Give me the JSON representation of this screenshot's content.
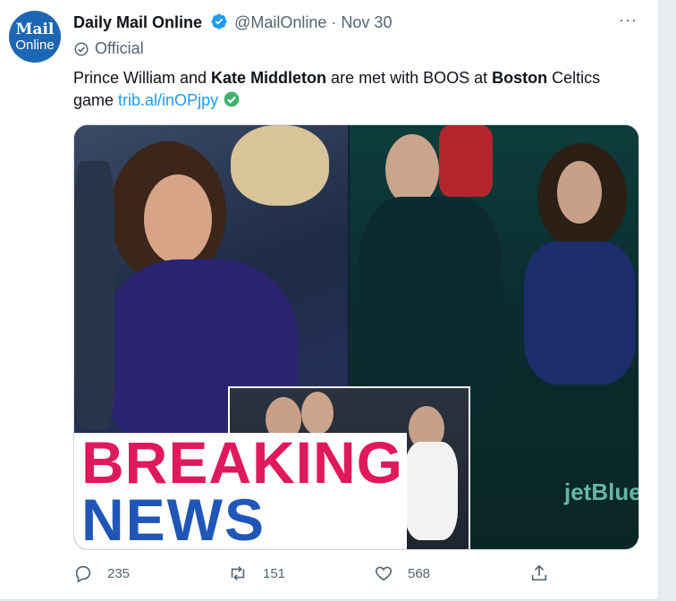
{
  "account": {
    "avatar_line1": "Mail",
    "avatar_line2": "Online",
    "display_name": "Daily Mail Online",
    "handle": "@MailOnline",
    "separator": "·",
    "date": "Nov 30",
    "badge": "Official",
    "verified_color": "#1d9bf0"
  },
  "tweet": {
    "text_parts": [
      {
        "text": "Prince William and ",
        "bold": false
      },
      {
        "text": "Kate Middleton",
        "bold": true
      },
      {
        "text": " are met with BOOS at ",
        "bold": false
      },
      {
        "text": "Boston",
        "bold": true
      },
      {
        "text": " Celtics game ",
        "bold": false
      }
    ],
    "link": "trib.al/inOPjpy",
    "link_color": "#1d9bf0"
  },
  "media": {
    "headline_line1": "BREAKING",
    "headline_line2": "NEWS",
    "headline_color1": "#e0195a",
    "headline_color2": "#1f56b8",
    "background_sign": "jetBlue"
  },
  "actions": {
    "reply_count": "235",
    "retweet_count": "151",
    "like_count": "568",
    "icons": [
      "reply-icon",
      "retweet-icon",
      "like-icon",
      "share-icon"
    ]
  }
}
